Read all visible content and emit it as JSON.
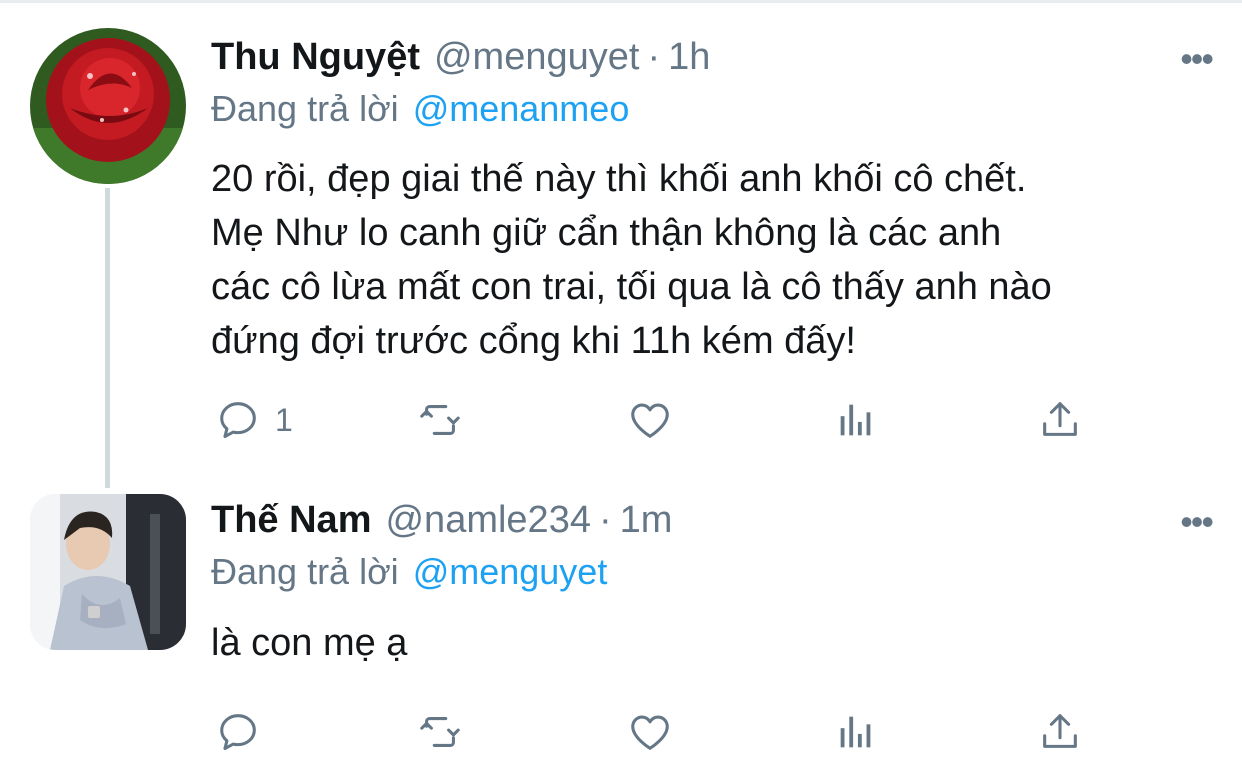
{
  "tweets": [
    {
      "name": "Thu Nguyệt",
      "handle": "@menguyet",
      "separator": "·",
      "time": "1h",
      "reply_prefix": "Đang trả lời",
      "reply_to": "@menanmeo",
      "text": "20 rồi, đẹp giai thế này thì khối anh khối cô chết.\nMẹ Như lo canh giữ cẩn thận không là các anh\ncác cô lừa mất con trai, tối qua là cô thấy anh nào\nđứng đợi trước cổng khi 11h kém đấy!",
      "more": "•••",
      "actions": {
        "reply_count": "1"
      },
      "icons": [
        "comment-icon",
        "retweet-icon",
        "heart-icon",
        "analytics-icon",
        "share-icon"
      ]
    },
    {
      "name": "Thế Nam",
      "handle": "@namle234",
      "separator": "·",
      "time": "1m",
      "reply_prefix": "Đang trả lời",
      "reply_to": "@menguyet",
      "text": "là con mẹ ạ",
      "more": "•••",
      "actions": {
        "reply_count": ""
      },
      "icons": [
        "comment-icon",
        "retweet-icon",
        "heart-icon",
        "analytics-icon",
        "share-icon"
      ]
    }
  ],
  "colors": {
    "mention": "#1da1f2",
    "muted": "#657786",
    "text": "#14171a",
    "thread_line": "#cfd9de"
  }
}
